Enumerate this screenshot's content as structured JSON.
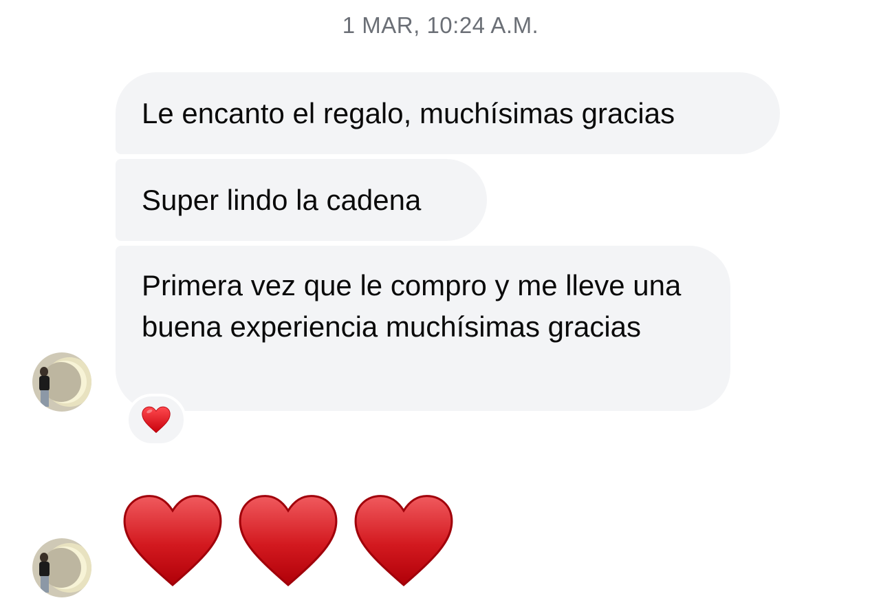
{
  "conversation": {
    "timestamp": "1 MAR, 10:24 A.M.",
    "messages": [
      {
        "text": "Le encanto el regalo, muchísimas gracias"
      },
      {
        "text": "Super lindo la cadena"
      },
      {
        "text": "Primera vez que le compro y me lleve una buena experiencia muchísimas gracias"
      }
    ],
    "reaction": {
      "icon": "red-heart-icon"
    },
    "emoji_message": {
      "icons": [
        "red-heart-icon",
        "red-heart-icon",
        "red-heart-icon"
      ]
    }
  },
  "colors": {
    "bubble": "#f3f4f6",
    "timestamp": "#6b6f76",
    "heart": "#d0161c"
  }
}
